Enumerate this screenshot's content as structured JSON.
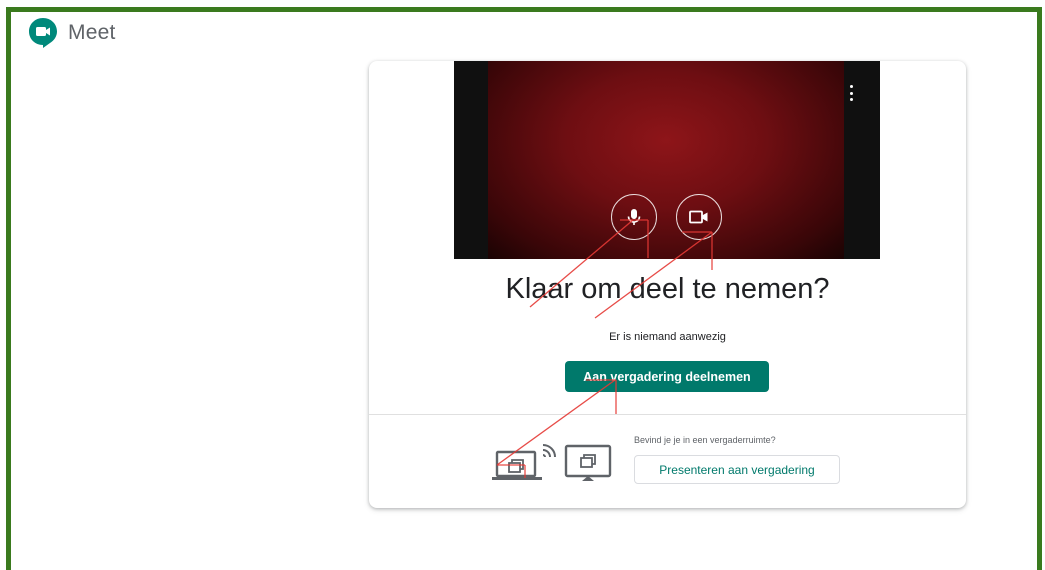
{
  "app": {
    "title": "Meet",
    "logo_icon": "google-meet-logo"
  },
  "preview": {
    "more_icon": "more-vert-icon",
    "mic_icon": "microphone-icon",
    "camera_icon": "video-camera-icon"
  },
  "main": {
    "heading": "Klaar om deel te nemen?",
    "status": "Er is niemand aanwezig",
    "join_label": "Aan vergadering deelnemen"
  },
  "room": {
    "question": "Bevind je je in een vergaderruimte?",
    "present_label": "Presenteren aan vergadering",
    "laptop_icon": "laptop-present-icon",
    "cast_icon": "cast-icon",
    "tv_icon": "tv-present-icon"
  },
  "colors": {
    "frame": "#3a7a1e",
    "accent": "#00796b",
    "annotation": "#e53935"
  }
}
